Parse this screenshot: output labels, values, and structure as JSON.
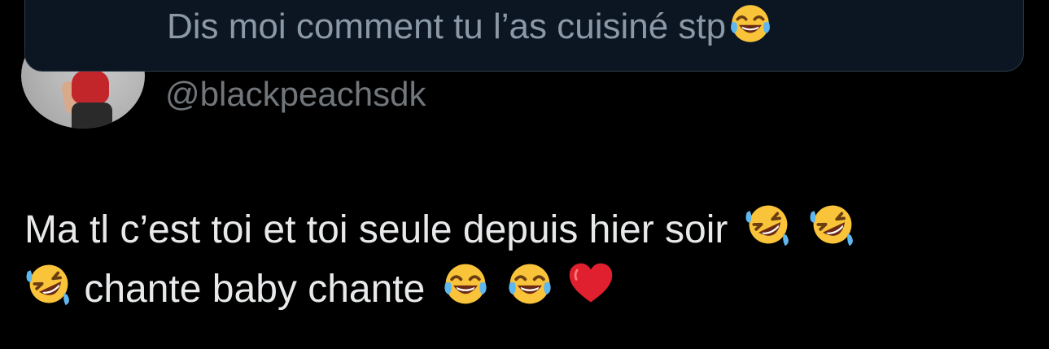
{
  "quoted_tweet": {
    "text": "Dis moi comment tu l’as cuisiné stp",
    "emoji": "face-with-tears-of-joy-icon"
  },
  "author": {
    "handle": "@blackpeachsdk"
  },
  "tweet": {
    "line1_text": "Ma tl c’est toi et toi seule depuis hier soir",
    "line2_text": "chante baby chante",
    "line1_emojis": [
      "rolling-on-floor-laughing-icon",
      "rolling-on-floor-laughing-icon"
    ],
    "line2_leading_emoji": "rolling-on-floor-laughing-icon",
    "line2_trailing_emojis": [
      "face-with-tears-of-joy-icon",
      "face-with-tears-of-joy-icon",
      "red-heart-icon"
    ]
  },
  "colors": {
    "background": "#000000",
    "text_primary": "#e7e9ea",
    "text_secondary": "#71767b",
    "quote_card_bg": "#0b1622",
    "quote_card_border": "#2f3b48"
  }
}
